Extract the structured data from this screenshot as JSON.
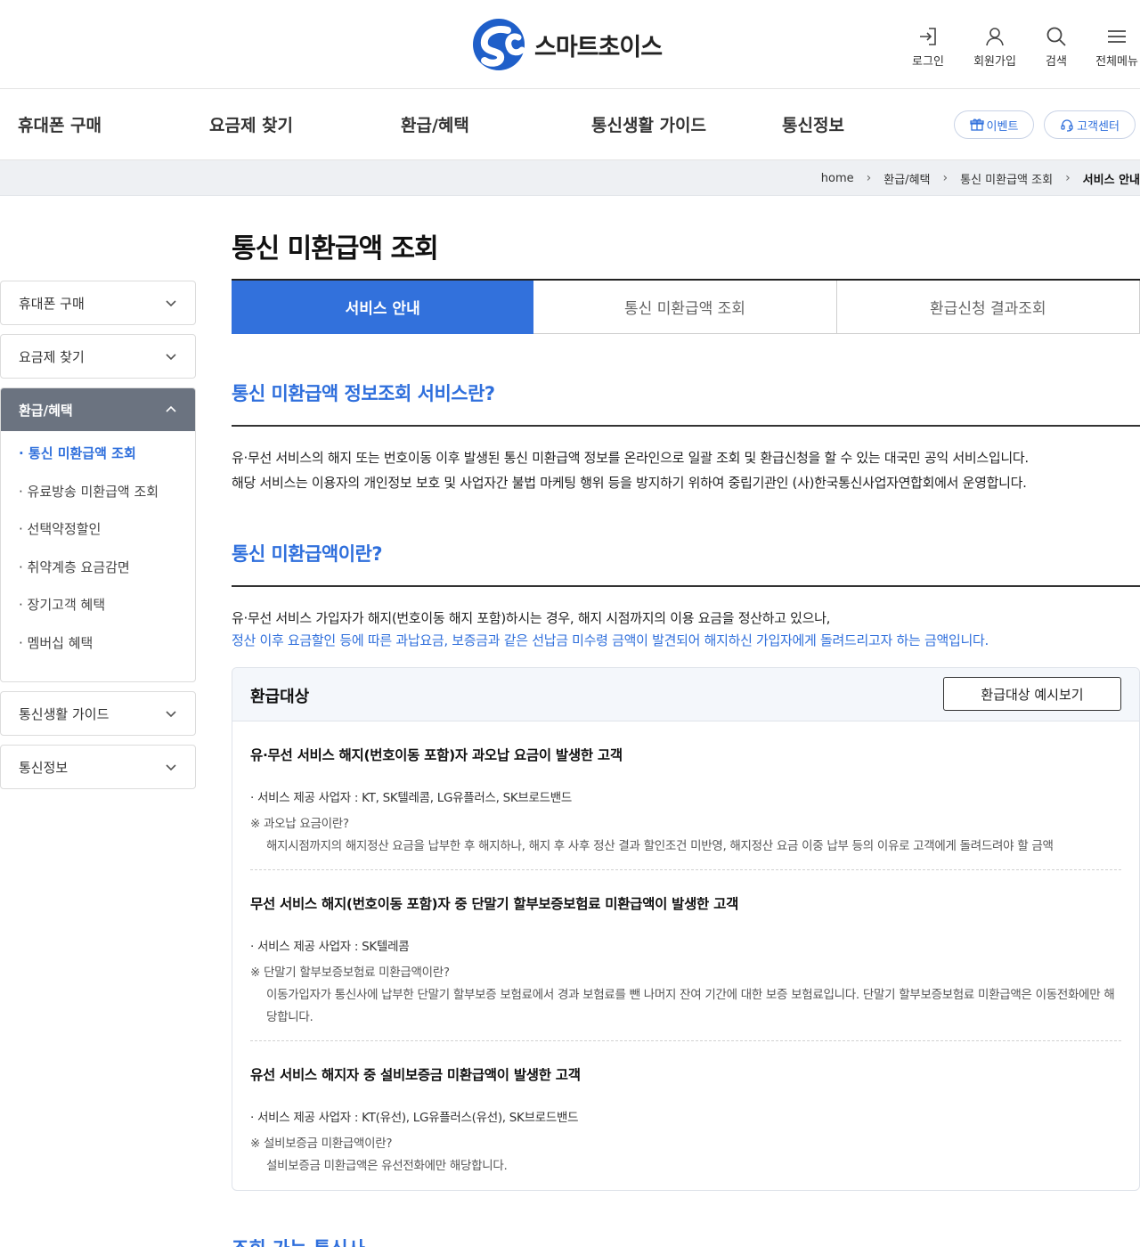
{
  "brand": {
    "name": "스마트초이스",
    "accent": "#3271dc"
  },
  "util_menu": [
    {
      "label": "로그인",
      "icon": "login-icon"
    },
    {
      "label": "회원가입",
      "icon": "user-icon"
    },
    {
      "label": "검색",
      "icon": "search-icon"
    },
    {
      "label": "전체메뉴",
      "icon": "menu-icon"
    }
  ],
  "gnb": {
    "items": [
      "휴대폰 구매",
      "요금제 찾기",
      "환급/혜택",
      "통신생활 가이드",
      "통신정보"
    ],
    "event_label": "이벤트",
    "support_label": "고객센터"
  },
  "breadcrumb": [
    "home",
    "환급/혜택",
    "통신 미환급액 조회",
    "서비스 안내"
  ],
  "sidenav": {
    "top": [
      "휴대폰 구매",
      "요금제 찾기"
    ],
    "open": {
      "label": "환급/혜택",
      "items": [
        "통신 미환급액 조회",
        "유료방송 미환급액 조회",
        "선택약정할인",
        "취약계층 요금감면",
        "장기고객 혜택",
        "멤버십 혜택"
      ]
    },
    "bottom": [
      "통신생활 가이드",
      "통신정보"
    ]
  },
  "page": {
    "title": "통신 미환급액 조회",
    "tabs": [
      "서비스 안내",
      "통신 미환급액 조회",
      "환급신청 결과조회"
    ],
    "section1": {
      "title": "통신 미환급액 정보조회 서비스란?",
      "lines": [
        "유·무선 서비스의 해지 또는 번호이동 이후 발생된 통신 미환급액 정보를 온라인으로 일괄 조회 및 환급신청을 할 수 있는 대국민 공익 서비스입니다.",
        "해당 서비스는 이용자의 개인정보 보호 및 사업자간 불법 마케팅 행위 등을 방지하기 위하여 중립기관인 (사)한국통신사업자연합회에서 운영합니다."
      ]
    },
    "section2": {
      "title": "통신 미환급액이란?",
      "line1": "유·무선 서비스 가입자가 해지(번호이동 해지 포함)하시는 경우, 해지 시점까지의 이용 요금을 정산하고 있으나,",
      "line2": "정산 이후 요금할인 등에 따른 과납요금, 보증금과 같은 선납금 미수령 금액이 발견되어 해지하신 가입자에게 돌려드리고자 하는 금액입니다."
    },
    "refund": {
      "title": "환급대상",
      "button": "환급대상 예시보기",
      "cases": [
        {
          "heading": "유·무선 서비스 해지(번호이동 포함)자 과오납 요금이 발생한 고객",
          "provider": "· 서비스 제공 사업자 : KT, SK텔레콤, LG유플러스, SK브로드밴드",
          "note": "※ 과오납 요금이란?",
          "desc": "해지시점까지의 해지정산 요금을 납부한 후 해지하나, 해지 후 사후 정산 결과 할인조건 미반영, 해지정산 요금 이중 납부 등의 이유로 고객에게 돌려드려야 할 금액"
        },
        {
          "heading": "무선 서비스 해지(번호이동 포함)자 중 단말기 할부보증보험료 미환급액이 발생한 고객",
          "provider": "· 서비스 제공 사업자 : SK텔레콤",
          "note": "※ 단말기 할부보증보험료 미환급액이란?",
          "desc": "이동가입자가 통신사에 납부한 단말기 할부보증 보험료에서 경과 보험료를 뺀 나머지 잔여 기간에 대한 보증 보험료입니다. 단말기 할부보증보험료 미환급액은 이동전화에만 해당합니다."
        },
        {
          "heading": "유선 서비스 해지자 중 설비보증금 미환급액이 발생한 고객",
          "provider": "· 서비스 제공 사업자 : KT(유선), LG유플러스(유선), SK브로드밴드",
          "note": "※ 설비보증금 미환급액이란?",
          "desc": "설비보증금 미환급액은 유선전화에만 해당합니다."
        }
      ]
    },
    "section3_title": "조회 가능 통신사"
  }
}
